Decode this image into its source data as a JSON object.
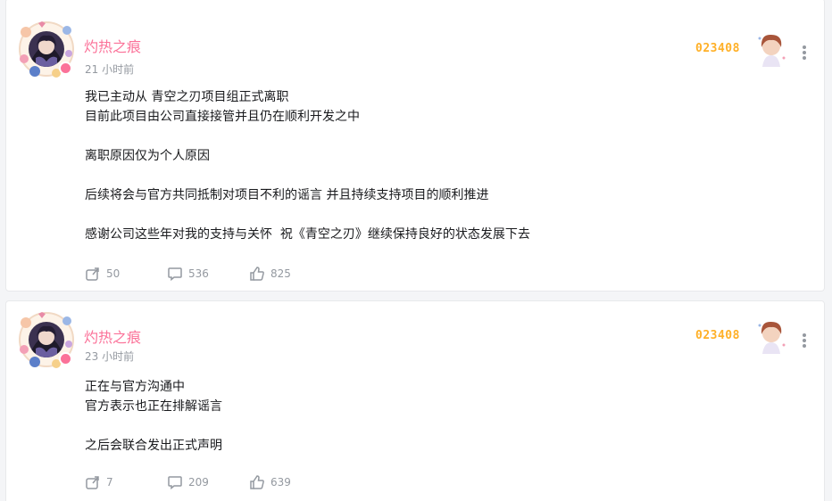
{
  "posts": [
    {
      "user": {
        "name": "灼热之痕"
      },
      "time": "21 小时前",
      "fan_number": "023408",
      "content": [
        "我已主动从 青空之刃项目组正式离职",
        "目前此项目由公司直接接管并且仍在顺利开发之中",
        "",
        "离职原因仅为个人原因",
        "",
        "后续将会与官方共同抵制对项目不利的谣言 并且持续支持项目的顺利推进",
        "",
        "感谢公司这些年对我的支持与关怀  祝《青空之刃》继续保持良好的状态发展下去"
      ],
      "stats": {
        "forward": "50",
        "comment": "536",
        "like": "825"
      }
    },
    {
      "user": {
        "name": "灼热之痕"
      },
      "time": "23 小时前",
      "fan_number": "023408",
      "content": [
        "正在与官方沟通中",
        "官方表示也正在排解谣言",
        "",
        "之后会联合发出正式声明"
      ],
      "stats": {
        "forward": "7",
        "comment": "209",
        "like": "639"
      }
    }
  ],
  "colors": {
    "username": "#fb7299",
    "fan_number": "#ffb027",
    "meta_gray": "#9499a0",
    "text": "#18191c",
    "page_bg": "#f4f5f7"
  },
  "icons": {
    "forward": "share-forward-icon",
    "comment": "comment-bubble-icon",
    "like": "thumbs-up-icon",
    "more": "more-vertical-icon",
    "verified": "verified-badge-icon"
  }
}
